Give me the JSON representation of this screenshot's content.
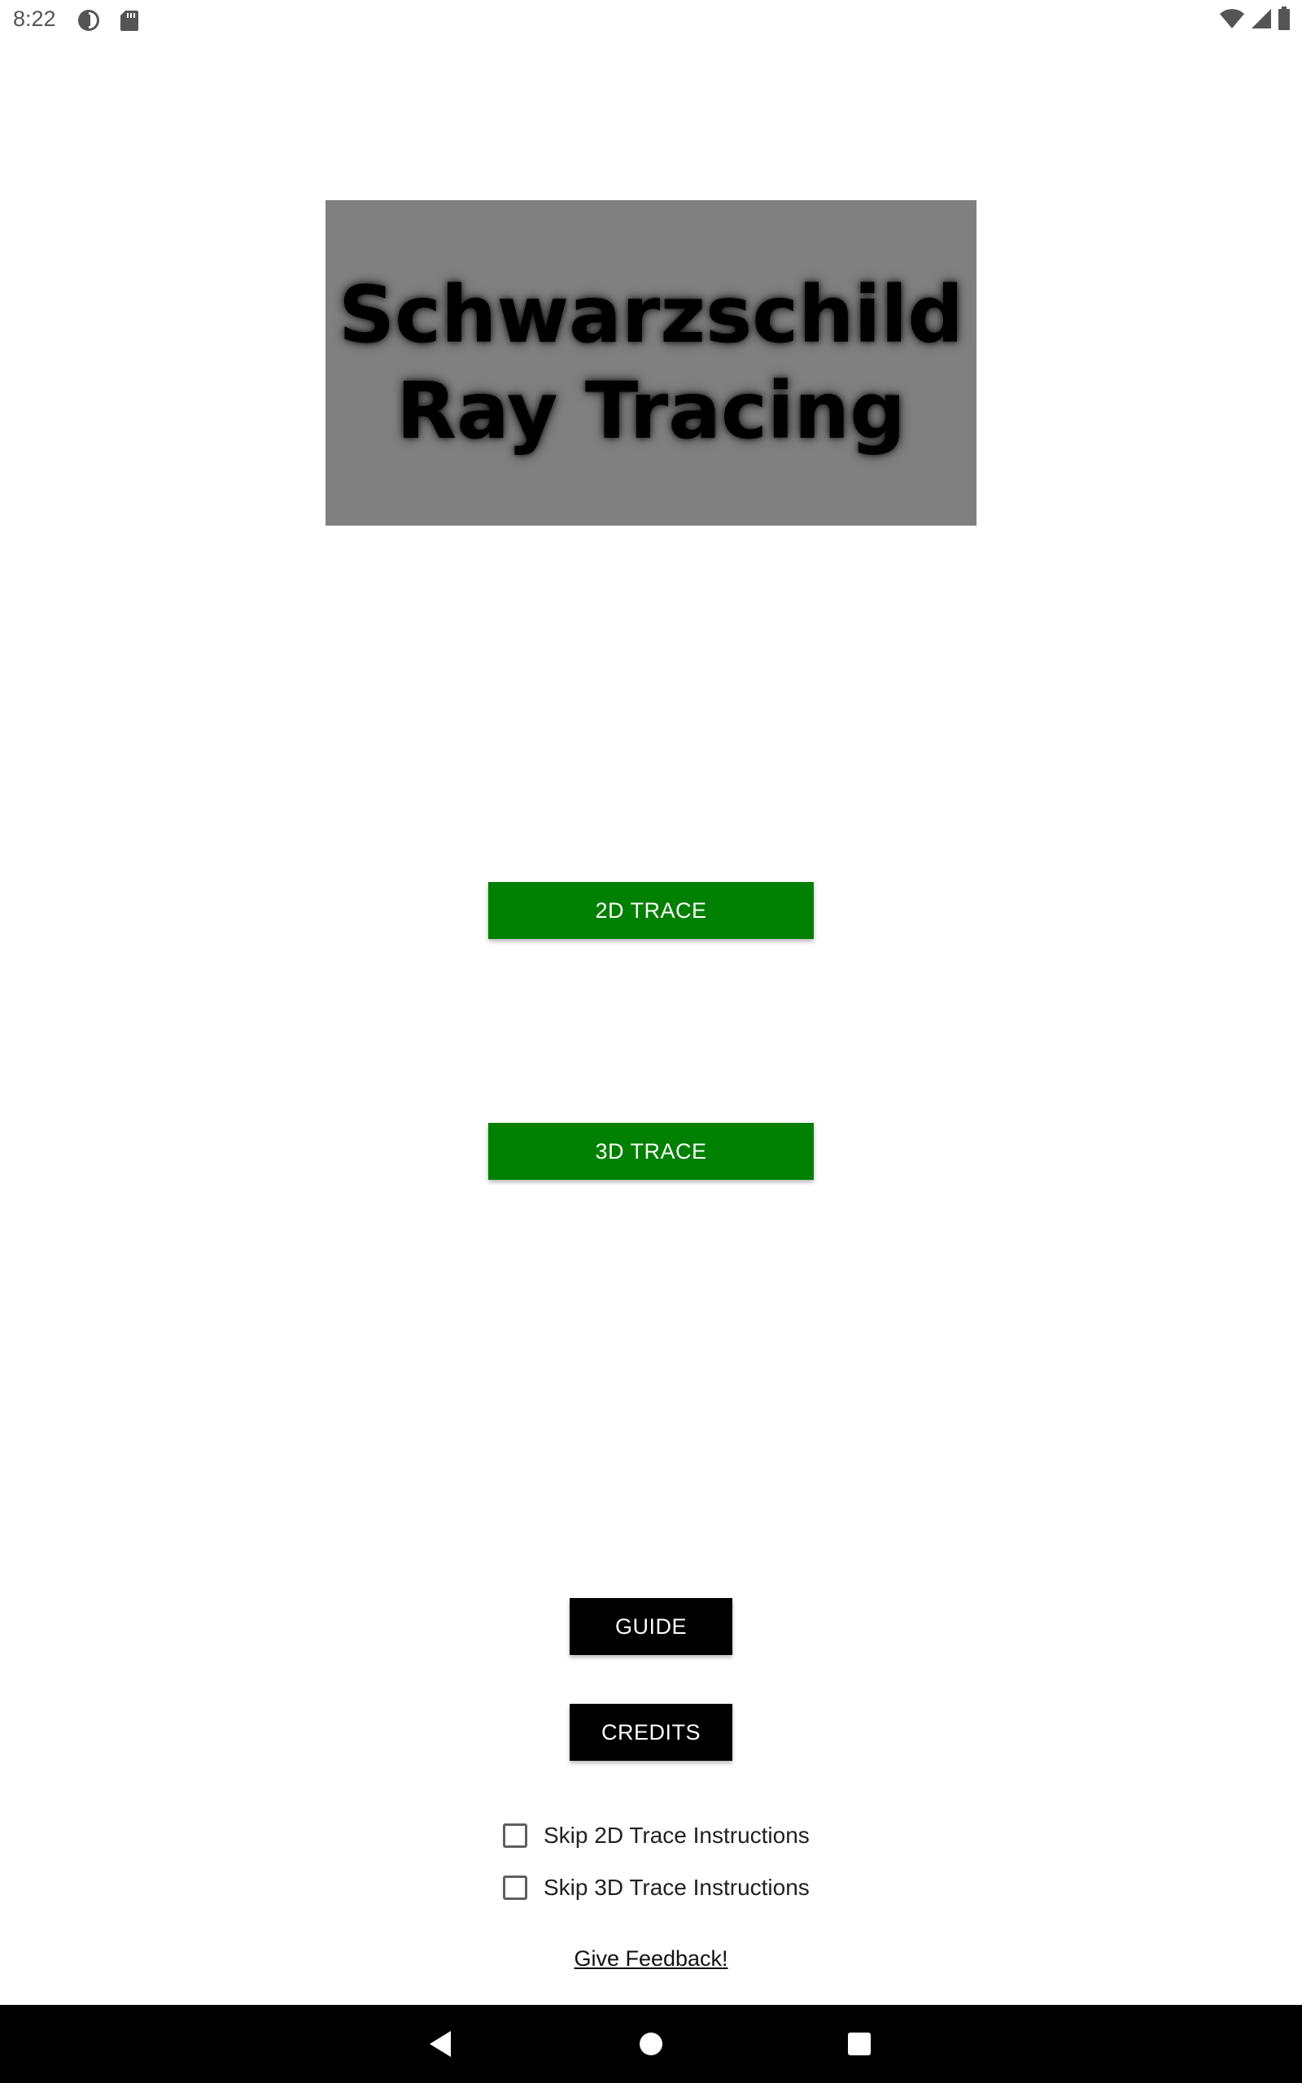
{
  "status_bar": {
    "time": "8:22",
    "left_icons": [
      "data-saver-icon",
      "sd-card-icon"
    ],
    "right_icons": [
      "wifi-icon",
      "cell-signal-icon",
      "battery-icon"
    ]
  },
  "title": {
    "line1": "Schwarzschild",
    "line2": "Ray Tracing",
    "box_color": "#808080"
  },
  "buttons": {
    "trace_2d": "2D TRACE",
    "trace_3d": "3D TRACE",
    "guide": "GUIDE",
    "credits": "CREDITS",
    "green_color": "#008000"
  },
  "checkboxes": [
    {
      "label": "Skip 2D Trace Instructions",
      "checked": false
    },
    {
      "label": "Skip 3D Trace Instructions",
      "checked": false
    }
  ],
  "feedback_link": "Give Feedback!",
  "nav_bar": {
    "icons": [
      "back-icon",
      "home-icon",
      "recents-icon"
    ]
  }
}
